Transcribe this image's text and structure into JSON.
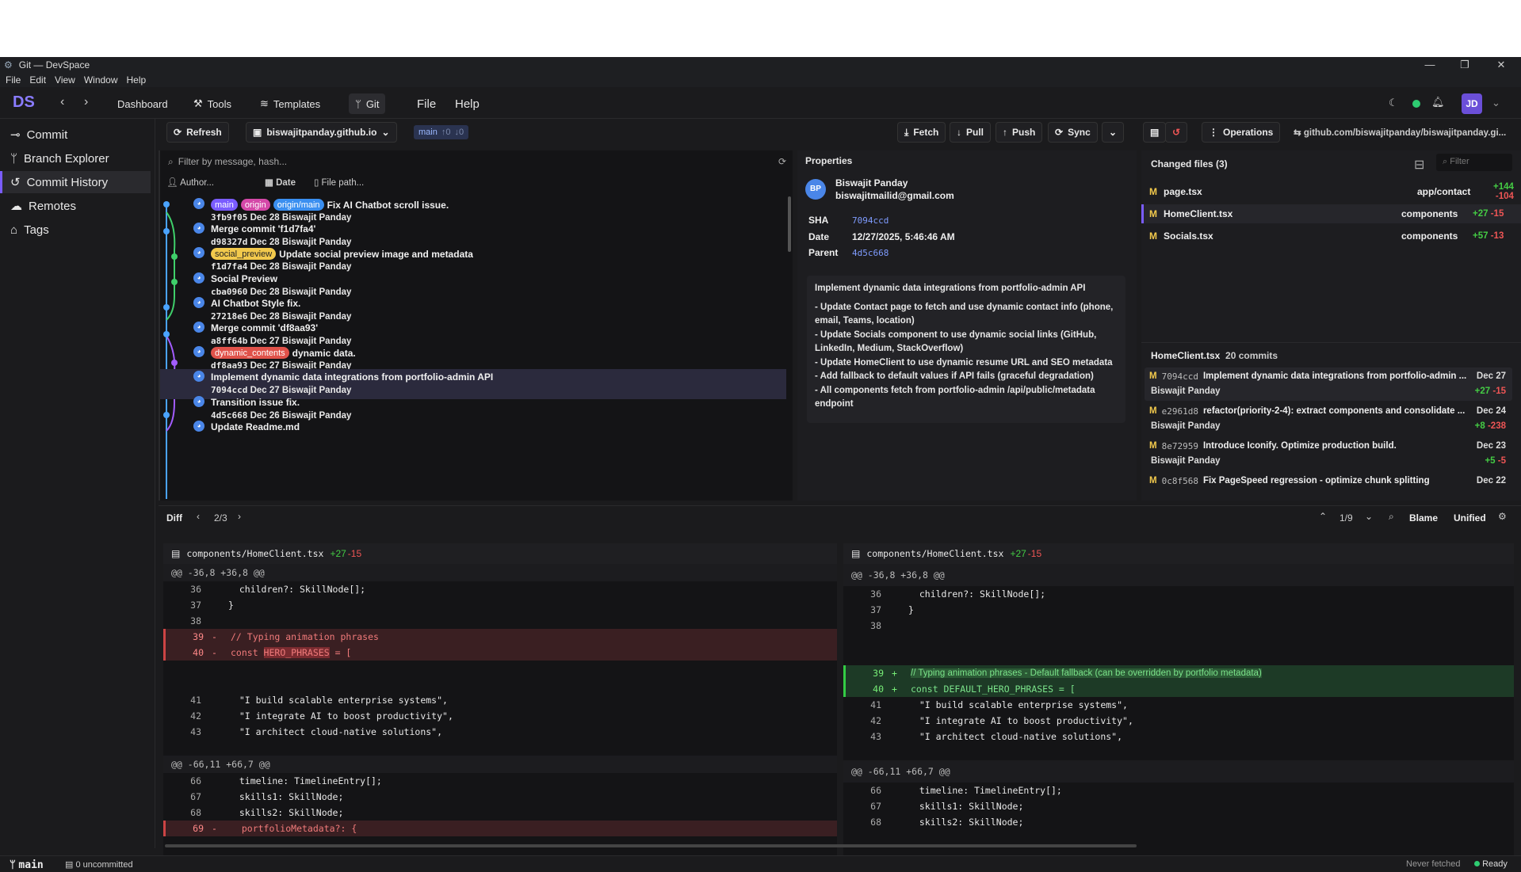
{
  "window": {
    "title": "Git — DevSpace"
  },
  "menu": [
    "File",
    "Edit",
    "View",
    "Window",
    "Help"
  ],
  "toolbar": {
    "logo": "DS",
    "nav": [
      "Dashboard",
      "Tools",
      "Templates",
      "Git"
    ],
    "extra": [
      "File",
      "Help"
    ],
    "avatar": "JD"
  },
  "sidebar": {
    "items": [
      "Commit",
      "Branch Explorer",
      "Commit History",
      "Remotes",
      "Tags"
    ]
  },
  "gitbar": {
    "refresh": "Refresh",
    "repo": "biswajitpanday.github.io",
    "branch": "main",
    "ahead": "↑0",
    "behind": "↓0",
    "fetch": "Fetch",
    "pull": "Pull",
    "push": "Push",
    "sync": "Sync",
    "operations": "Operations",
    "remote": "github.com/biswajitpanday/biswajitpanday.gi..."
  },
  "commits_panel": {
    "filter_placeholder": "Filter by message, hash...",
    "author": "Author...",
    "date": "Date",
    "filepath": "File path..."
  },
  "commits": [
    {
      "tags": [
        "main",
        "origin",
        "origin/main"
      ],
      "msg": "Fix AI Chatbot scroll issue.",
      "hash": "3fb9f05",
      "date": "Dec 28",
      "author": "Biswajit Panday"
    },
    {
      "tags": [],
      "msg": "Merge commit 'f1d7fa4'",
      "hash": "d98327d",
      "date": "Dec 28",
      "author": "Biswajit Panday"
    },
    {
      "tags": [
        "social_preview"
      ],
      "msg": "Update social preview image and metadata",
      "hash": "f1d7fa4",
      "date": "Dec 28",
      "author": "Biswajit Panday"
    },
    {
      "tags": [],
      "msg": "Social Preview",
      "hash": "cba0960",
      "date": "Dec 28",
      "author": "Biswajit Panday"
    },
    {
      "tags": [],
      "msg": "AI Chatbot Style fix.",
      "hash": "27218e6",
      "date": "Dec 28",
      "author": "Biswajit Panday"
    },
    {
      "tags": [],
      "msg": "Merge commit 'df8aa93'",
      "hash": "a8ff64b",
      "date": "Dec 27",
      "author": "Biswajit Panday"
    },
    {
      "tags": [
        "dynamic_contents"
      ],
      "msg": "dynamic data.",
      "hash": "df8aa93",
      "date": "Dec 27",
      "author": "Biswajit Panday"
    },
    {
      "tags": [],
      "msg": "Implement dynamic data integrations from portfolio-admin API",
      "hash": "7094ccd",
      "date": "Dec 27",
      "author": "Biswajit Panday"
    },
    {
      "tags": [],
      "msg": "Transition issue fix.",
      "hash": "4d5c668",
      "date": "Dec 26",
      "author": "Biswajit Panday"
    },
    {
      "tags": [],
      "msg": "Update Readme.md",
      "hash": "",
      "date": "",
      "author": ""
    }
  ],
  "properties": {
    "title": "Properties",
    "initials": "BP",
    "name": "Biswajit Panday",
    "email": "biswajitmailid@gmail.com",
    "sha_label": "SHA",
    "sha": "7094ccd",
    "date_label": "Date",
    "date": "12/27/2025, 5:46:46 AM",
    "parent_label": "Parent",
    "parent": "4d5c668",
    "message": [
      "Implement dynamic data integrations from portfolio-admin API",
      "- Update Contact page to fetch and use dynamic contact info (phone, email, Teams, location)",
      "- Update Socials component to use dynamic social links (GitHub, LinkedIn, Medium, StackOverflow)",
      "- Update HomeClient to use dynamic resume URL and SEO metadata",
      "- Add fallback to default values if API fails (graceful degradation)",
      "- All components fetch from portfolio-admin /api/public/metadata endpoint"
    ]
  },
  "changed": {
    "title": "Changed files (3)",
    "filter": "Filter",
    "files": [
      {
        "name": "page.tsx",
        "dir": "app/contact",
        "add": "+144",
        "del": "-104"
      },
      {
        "name": "HomeClient.tsx",
        "dir": "components",
        "add": "+27",
        "del": "-15"
      },
      {
        "name": "Socials.tsx",
        "dir": "components",
        "add": "+57",
        "del": "-13"
      }
    ],
    "history_file": "HomeClient.tsx",
    "history_count": "20 commits",
    "history": [
      {
        "hash": "7094ccd",
        "msg": "Implement dynamic data integrations from portfolio-admin ...",
        "date": "Dec 27",
        "author": "Biswajit Panday",
        "add": "+27",
        "del": "-15"
      },
      {
        "hash": "e2961d8",
        "msg": "refactor(priority-2-4): extract components and consolidate ...",
        "date": "Dec 24",
        "author": "Biswajit Panday",
        "add": "+8",
        "del": "-238"
      },
      {
        "hash": "8e72959",
        "msg": "Introduce Iconify. Optimize production build.",
        "date": "Dec 23",
        "author": "Biswajit Panday",
        "add": "+5",
        "del": "-5"
      },
      {
        "hash": "0c8f568",
        "msg": "Fix PageSpeed regression - optimize chunk splitting",
        "date": "Dec 22",
        "author": "",
        "add": "",
        "del": ""
      }
    ]
  },
  "diffbar": {
    "label": "Diff",
    "pos": "2/3",
    "hunk": "1/9",
    "blame": "Blame",
    "mode": "Unified"
  },
  "diff": {
    "file": "components/HomeClient.tsx",
    "add": "+27",
    "del": "-15",
    "hunk1": "@@ -36,8 +36,8 @@",
    "hunk2": "@@ -66,11 +66,7 @@"
  },
  "status": {
    "branch": "main",
    "uncommitted": "0 uncommitted",
    "fetched": "Never fetched",
    "ready": "Ready"
  }
}
